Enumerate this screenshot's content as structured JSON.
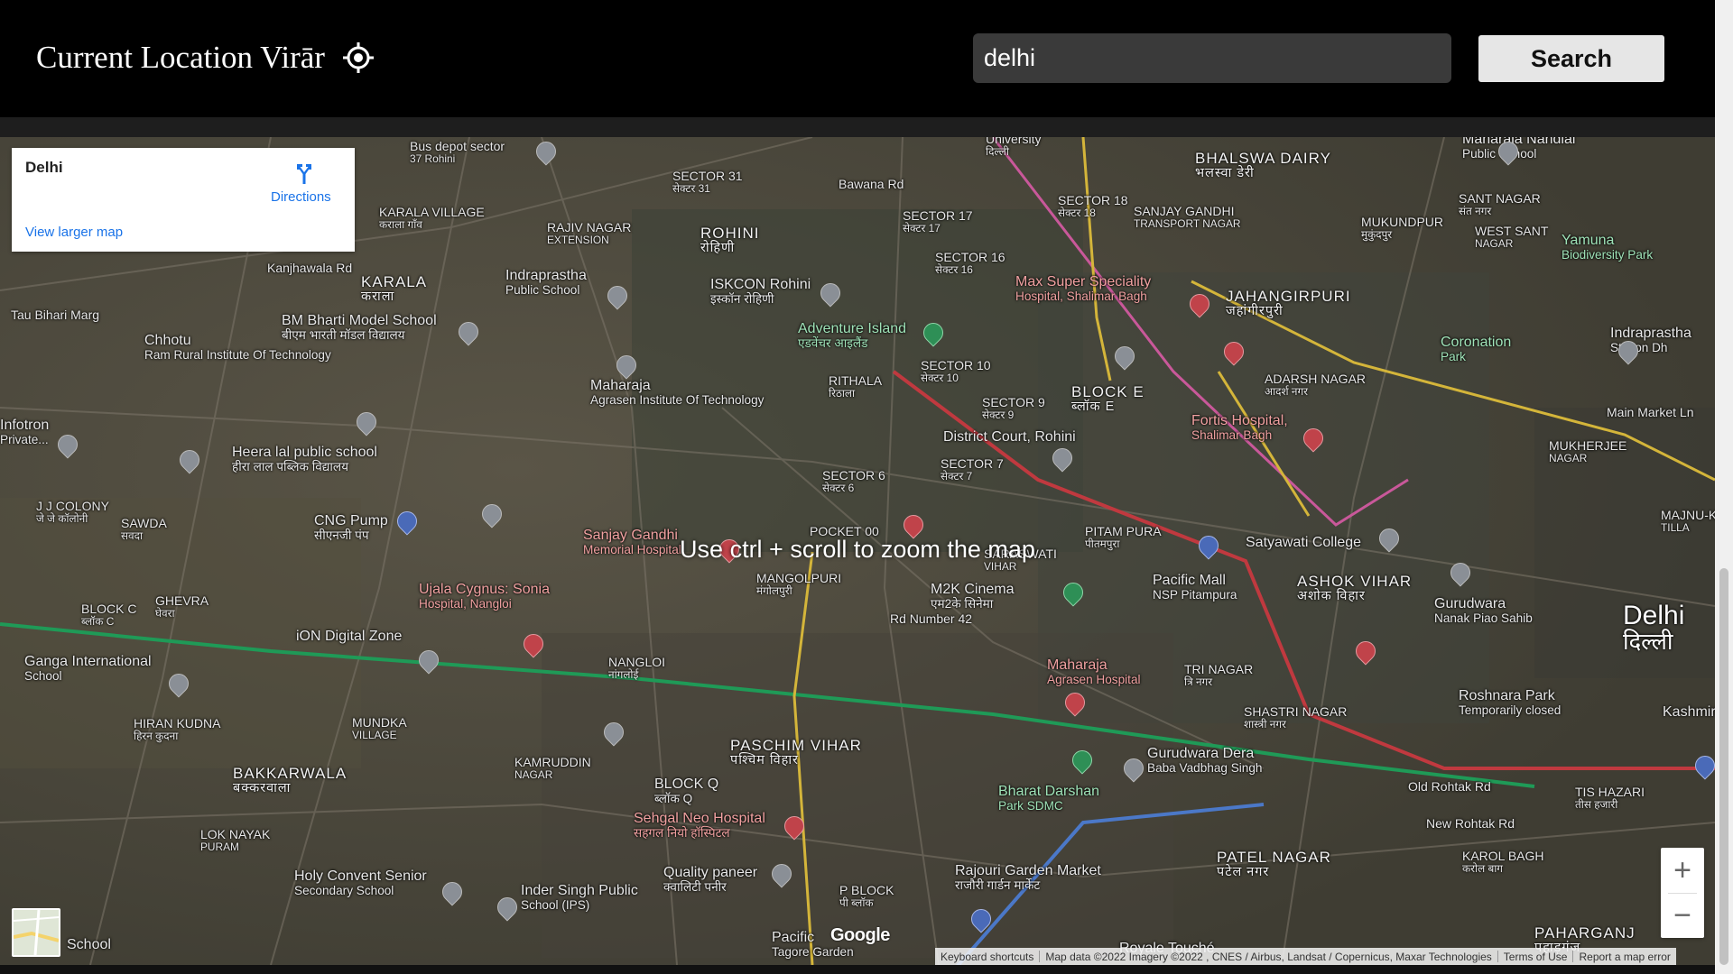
{
  "header": {
    "location_title": "Current Location Virār",
    "locate_icon": "crosshair-icon",
    "search_value": "delhi",
    "search_button_label": "Search"
  },
  "info_card": {
    "place_name": "Delhi",
    "directions_label": "Directions",
    "directions_icon": "directions-icon",
    "larger_map_label": "View larger map"
  },
  "map": {
    "hint": "Use ctrl + scroll to zoom the map",
    "zoom_in_label": "+",
    "zoom_out_label": "−",
    "logo": "Google",
    "attribution": {
      "shortcuts": "Keyboard shortcuts",
      "map_data": "Map data ©2022 Imagery ©2022 , CNES / Airbus, Landsat / Copernicus, Maxar Technologies",
      "terms": "Terms of Use",
      "report": "Report a map error"
    },
    "labels": [
      {
        "text": "Bus depot sector",
        "sub": "37 Rohini"
      },
      {
        "text": "SECTOR 31",
        "sub": "सेक्टर 31"
      },
      {
        "text": "University",
        "sub": "दिल्ली"
      },
      {
        "text": "BHALSWA DAIRY",
        "sub": "भलस्वा डेरी"
      },
      {
        "text": "Maharaja Nandlal",
        "sub": "Public School"
      },
      {
        "text": "KARALA VILLAGE",
        "sub": "कराला गाँव"
      },
      {
        "text": "RAJIV NAGAR",
        "sub": "EXTENSION"
      },
      {
        "text": "ROHINI",
        "sub": "रोहिणी"
      },
      {
        "text": "Bawana Rd",
        "sub": ""
      },
      {
        "text": "SECTOR 17",
        "sub": "सेक्टर 17"
      },
      {
        "text": "SECTOR 18",
        "sub": "सेक्टर 18"
      },
      {
        "text": "SANJAY GANDHI",
        "sub": "TRANSPORT NAGAR"
      },
      {
        "text": "MUKUNDPUR",
        "sub": "मुकुंदपुर"
      },
      {
        "text": "SANT NAGAR",
        "sub": "संत नगर"
      },
      {
        "text": "Kanjhawala Rd",
        "sub": ""
      },
      {
        "text": "KARALA",
        "sub": "कराला"
      },
      {
        "text": "Indraprastha",
        "sub": "Public School"
      },
      {
        "text": "ISKCON Rohini",
        "sub": "इस्कॉन रोहिणी"
      },
      {
        "text": "SECTOR 16",
        "sub": "सेक्टर 16"
      },
      {
        "text": "Max Super Speciality",
        "sub": "Hospital, Shalimar Bagh"
      },
      {
        "text": "JAHANGIRPURI",
        "sub": "जहांगीरपुरी"
      },
      {
        "text": "WEST SANT",
        "sub": "NAGAR"
      },
      {
        "text": "Yamuna",
        "sub": "Biodiversity Park"
      },
      {
        "text": "Tau Bihari Marg",
        "sub": ""
      },
      {
        "text": "Chhotu",
        "sub": "Ram Rural Institute Of Technology"
      },
      {
        "text": "BM Bharti Model School",
        "sub": "बीएम भारती मॉडल विद्यालय"
      },
      {
        "text": "Adventure Island",
        "sub": "एडवेंचर आइलैंड"
      },
      {
        "text": "Coronation",
        "sub": "Park"
      },
      {
        "text": "Indraprastha",
        "sub": "Station Dh"
      },
      {
        "text": "Maharaja",
        "sub": "Agrasen Institute Of Technology"
      },
      {
        "text": "RITHALA",
        "sub": "रिठाला"
      },
      {
        "text": "SECTOR 10",
        "sub": "सेक्टर 10"
      },
      {
        "text": "BLOCK E",
        "sub": "ब्लॉक E"
      },
      {
        "text": "ADARSH NAGAR",
        "sub": "आदर्श नगर"
      },
      {
        "text": "Infotron",
        "sub": "Private..."
      },
      {
        "text": "SECTOR 9",
        "sub": "सेक्टर 9"
      },
      {
        "text": "Fortis Hospital,",
        "sub": "Shalimar Bagh"
      },
      {
        "text": "Main Market Ln",
        "sub": ""
      },
      {
        "text": "MUKHERJEE",
        "sub": "NAGAR"
      },
      {
        "text": "Heera lal public school",
        "sub": "हीरा लाल पब्लिक विद्यालय"
      },
      {
        "text": "District Court, Rohini",
        "sub": ""
      },
      {
        "text": "SECTOR 6",
        "sub": "सेक्टर 6"
      },
      {
        "text": "SECTOR 7",
        "sub": "सेक्टर 7"
      },
      {
        "text": "J J COLONY",
        "sub": "जे जे कॉलोनी"
      },
      {
        "text": "SAWDA",
        "sub": "सवदा"
      },
      {
        "text": "CNG Pump",
        "sub": "सीएनजी पंप"
      },
      {
        "text": "Sanjay Gandhi",
        "sub": "Memorial Hospital"
      },
      {
        "text": "POCKET 00",
        "sub": ""
      },
      {
        "text": "SARASWATI",
        "sub": "VIHAR"
      },
      {
        "text": "PITAM PURA",
        "sub": "पीतमपुरा"
      },
      {
        "text": "Satyawati College",
        "sub": ""
      },
      {
        "text": "MAJNU-KA-",
        "sub": "TILLA"
      },
      {
        "text": "Delhi",
        "sub": "दिल्ली"
      },
      {
        "text": "BLOCK C",
        "sub": "ब्लॉक C"
      },
      {
        "text": "GHEVRA",
        "sub": "घेवरा"
      },
      {
        "text": "Ujala Cygnus: Sonia",
        "sub": "Hospital, Nangloi"
      },
      {
        "text": "MANGOLPURI",
        "sub": "मंगोलपुरी"
      },
      {
        "text": "M2K Cinema",
        "sub": "एम2के सिनेमा"
      },
      {
        "text": "Pacific Mall",
        "sub": "NSP Pitampura"
      },
      {
        "text": "ASHOK VIHAR",
        "sub": "अशोक विहार"
      },
      {
        "text": "Gurudwara",
        "sub": "Nanak Piao Sahib"
      },
      {
        "text": "iON Digital Zone",
        "sub": ""
      },
      {
        "text": "Ganga International",
        "sub": "School"
      },
      {
        "text": "NANGLOI",
        "sub": "नांगलोई"
      },
      {
        "text": "Rd Number 42",
        "sub": ""
      },
      {
        "text": "Maharaja",
        "sub": "Agrasen Hospital"
      },
      {
        "text": "TRI NAGAR",
        "sub": "त्रि नगर"
      },
      {
        "text": "Roshnara Park",
        "sub": "Temporarily closed"
      },
      {
        "text": "Kashmiri Ga",
        "sub": ""
      },
      {
        "text": "HIRAN KUDNA",
        "sub": "हिरन कुदना"
      },
      {
        "text": "MUNDKA",
        "sub": "VILLAGE"
      },
      {
        "text": "SHASTRI NAGAR",
        "sub": "शास्त्री नगर"
      },
      {
        "text": "PASCHIM VIHAR",
        "sub": "पश्चिम विहार"
      },
      {
        "text": "KAMRUDDIN",
        "sub": "NAGAR"
      },
      {
        "text": "Gurudwara Dera",
        "sub": "Baba Vadbhag Singh"
      },
      {
        "text": "BAKKARWALA",
        "sub": "बक्करवाला"
      },
      {
        "text": "BLOCK Q",
        "sub": "ब्लॉक Q"
      },
      {
        "text": "Bharat Darshan",
        "sub": "Park SDMC"
      },
      {
        "text": "Old Rohtak Rd",
        "sub": ""
      },
      {
        "text": "TIS HAZARI",
        "sub": "तीस हजारी"
      },
      {
        "text": "Sehgal Neo Hospital",
        "sub": "सहगल नियो हॉस्पिटल"
      },
      {
        "text": "New Rohtak Rd",
        "sub": ""
      },
      {
        "text": "LOK NAYAK",
        "sub": "PURAM"
      },
      {
        "text": "PATEL NAGAR",
        "sub": "पटेल नगर"
      },
      {
        "text": "KAROL BAGH",
        "sub": "करोल बाग"
      },
      {
        "text": "Holy Convent Senior",
        "sub": "Secondary School"
      },
      {
        "text": "Inder Singh Public",
        "sub": "School (IPS)"
      },
      {
        "text": "Quality paneer",
        "sub": "क्वालिटी पनीर"
      },
      {
        "text": "P BLOCK",
        "sub": "पी ब्लॉक"
      },
      {
        "text": "Rajouri Garden Market",
        "sub": "राजौरी गार्डन मार्केट"
      },
      {
        "text": "School",
        "sub": ""
      },
      {
        "text": "Pacific",
        "sub": "Tagore Garden"
      },
      {
        "text": "PAHARGANJ",
        "sub": "पहाड़गंज"
      },
      {
        "text": "Royale Touché",
        "sub": ""
      }
    ]
  },
  "colors": {
    "header_bg": "#000000",
    "search_bg": "#3a3a3a",
    "button_bg": "#e6e6e6",
    "map_bg": "#4d4a3d",
    "link_blue": "#1a73e8",
    "metro_red": "#c0393f",
    "metro_green": "#1f9a57",
    "highway_yellow": "#d4b53a"
  }
}
